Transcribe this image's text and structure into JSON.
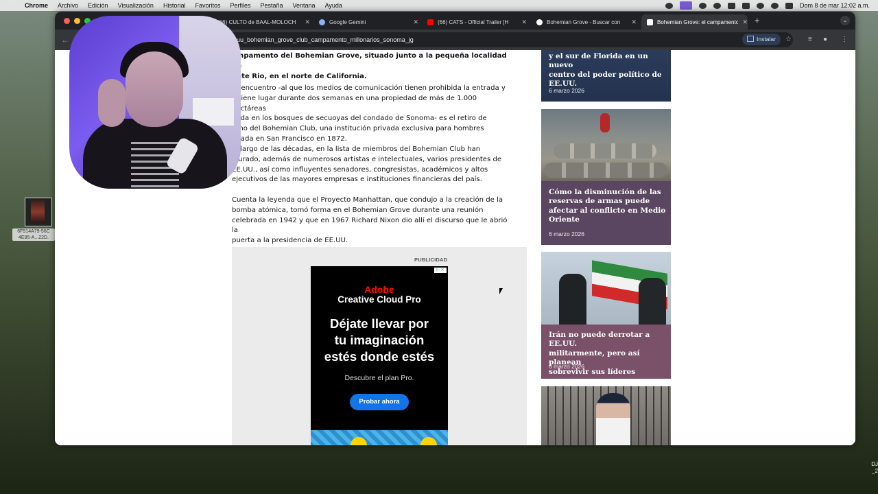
{
  "menubar": {
    "app": "Chrome",
    "items": [
      "Archivo",
      "Edición",
      "Visualización",
      "Historial",
      "Favoritos",
      "Perfiles",
      "Pestaña",
      "Ventana",
      "Ayuda"
    ],
    "clock": "Dom 8 de mar  12:02 a.m."
  },
  "desktop": {
    "file_label": "6F914A79-56C\n4E85-A...22D.",
    "corner_text": "DJ\n_2"
  },
  "browser": {
    "tabs": [
      {
        "title": "(66) CULTO de BAAL-MOLOCH",
        "favicon_color": "#ff0000"
      },
      {
        "title": "Google Gemini",
        "favicon_color": "#8ab4f8"
      },
      {
        "title": "(66) CATS - Official Trailer [H",
        "favicon_color": "#ff0000"
      },
      {
        "title": "Bohemian Grove - Buscar con",
        "favicon_color": "#ffffff"
      },
      {
        "title": "Bohemian Grove: el campamento",
        "favicon_color": "#ffffff",
        "active": true
      }
    ],
    "url": "130722_eeuu_bohemian_grove_club_campamento_millonarios_sonoma_jg",
    "install_label": "Instalar"
  },
  "article": {
    "lead": "ampamento del Bohemian Grove, situado junto a la pequeña localidad de\nonte Rio, en el norte de California.",
    "p1": "te encuentro -al que los medios de comunicación tienen prohibida la entrada y\ne tiene lugar durante dos semanas en una propiedad de más de 1.000 hectáreas\nuada en los bosques de secuoyas del condado de Sonoma- es el retiro de\nrano del Bohemian Club, una institución privada exclusiva para hombres\nndada en San Francisco en 1872.",
    "p2": "lo largo de las décadas, en la lista de miembros del Bohemian Club han\nigurado, además de numerosos artistas e intelectuales, varios presidentes de\nEE.UU., así como influyentes senadores, congresistas, académicos y altos\nejecutivos de las mayores empresas e instituciones financieras del país.",
    "p3": "Cuenta la leyenda que el Proyecto Manhattan, que condujo a la creación de la\nbomba atómica, tomó forma en el Bohemian Grove durante una reunión\ncelebrada en 1942 y que en 1967 Richard Nixon dio allí el discurso que le abrió la\npuerta a la presidencia de EE.UU."
  },
  "ad": {
    "label": "PUBLICIDAD",
    "brand": "Adobe",
    "product": "Creative Cloud Pro",
    "headline": "Déjate llevar por\ntu imaginación\nestés donde estés",
    "subtext": "Descubre el plan Pro.",
    "cta": "Probar ahora"
  },
  "sidebar": {
    "cards": [
      {
        "title": "y el sur de Florida en un nuevo\ncentro del poder político de\nEE.UU.",
        "date": "6 marzo 2026"
      },
      {
        "title": "Cómo la disminución de las\nreservas de armas puede\nafectar al conflicto en Medio\nOriente",
        "date": "6 marzo 2026"
      },
      {
        "title": "Irán no puede derrotar a EE.UU.\nmilitarmente, pero así planean\nsobrevivir sus líderes",
        "date": "6 marzo 2026"
      },
      {
        "title": "",
        "date": ""
      }
    ]
  },
  "colors": {
    "tab_strip": "#202124",
    "toolbar": "#35363a",
    "card1_overlay": "#22324f",
    "card2_overlay": "#5a4660",
    "card3_overlay": "#7a5168",
    "ad_button": "#1473e6",
    "adobe_red": "#fa0f00"
  }
}
